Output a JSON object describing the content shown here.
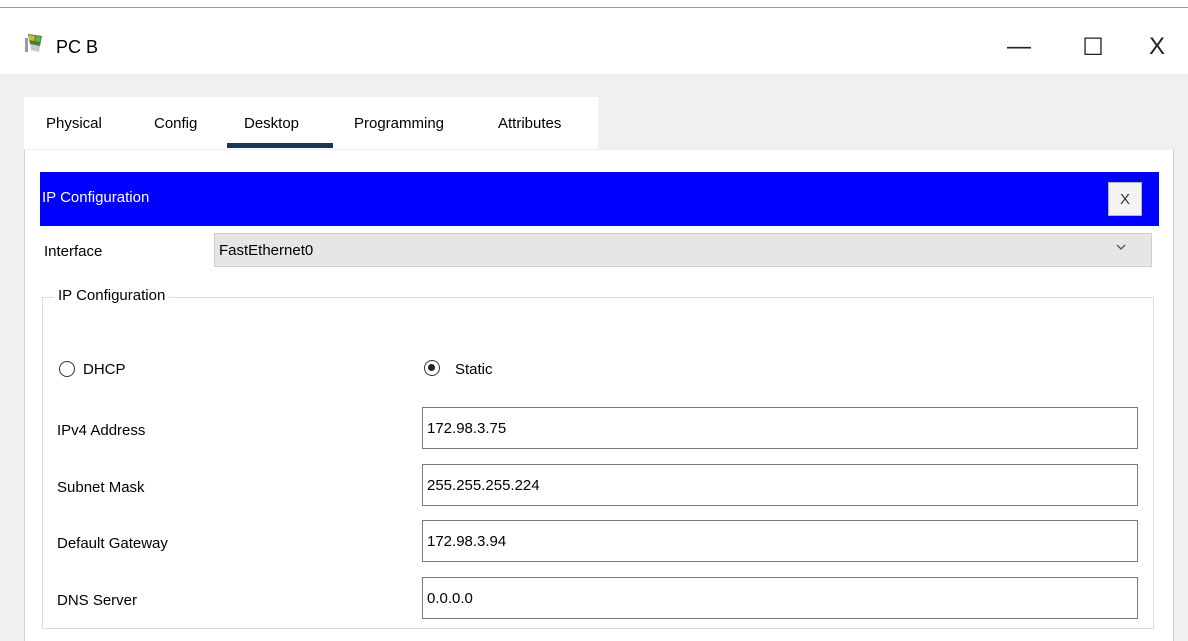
{
  "window": {
    "title": "PC B",
    "icon": "pc-icon",
    "controls": {
      "minimize": "—",
      "maximize": "☐",
      "close": "X"
    }
  },
  "tabs": [
    {
      "label": "Physical"
    },
    {
      "label": "Config"
    },
    {
      "label": "Desktop"
    },
    {
      "label": "Programming"
    },
    {
      "label": "Attributes"
    }
  ],
  "active_tab": "Desktop",
  "ip_config": {
    "header_title": "IP Configuration",
    "close_label": "X",
    "interface_label": "Interface",
    "interface_value": "FastEthernet0",
    "group_title": "IP Configuration",
    "mode_options": [
      {
        "label": "DHCP",
        "selected": false
      },
      {
        "label": "Static",
        "selected": true
      }
    ],
    "fields": [
      {
        "label": "IPv4 Address",
        "value": "172.98.3.75"
      },
      {
        "label": "Subnet Mask",
        "value": "255.255.255.224"
      },
      {
        "label": "Default Gateway",
        "value": "172.98.3.94"
      },
      {
        "label": "DNS Server",
        "value": "0.0.0.0"
      }
    ]
  },
  "colors": {
    "header_bar": "#0000ff",
    "active_tab_underline": "#1d3557"
  }
}
